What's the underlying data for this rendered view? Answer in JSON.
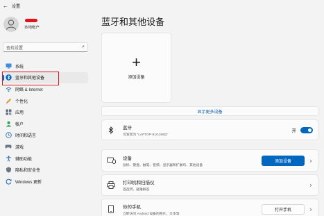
{
  "titlebar": {
    "back_icon": "back-arrow-icon",
    "title": "设置"
  },
  "profile": {
    "account_type": "本地帐户"
  },
  "search": {
    "placeholder": "查找设置"
  },
  "nav": [
    {
      "label": "系统",
      "icon": "monitor-icon"
    },
    {
      "label": "蓝牙和其他设备",
      "icon": "bluetooth-icon"
    },
    {
      "label": "网络 & Internet",
      "icon": "wifi-icon"
    },
    {
      "label": "个性化",
      "icon": "brush-icon"
    },
    {
      "label": "应用",
      "icon": "apps-icon"
    },
    {
      "label": "帐户",
      "icon": "person-icon"
    },
    {
      "label": "时间和语言",
      "icon": "globe-clock-icon"
    },
    {
      "label": "游戏",
      "icon": "controller-icon"
    },
    {
      "label": "辅助功能",
      "icon": "accessibility-icon"
    },
    {
      "label": "隐私和安全性",
      "icon": "shield-icon"
    },
    {
      "label": "Windows 更新",
      "icon": "update-icon"
    }
  ],
  "main": {
    "title": "蓝牙和其他设备",
    "add_device_label": "添加设备",
    "show_more": "显示更多设备",
    "bluetooth": {
      "title": "蓝牙",
      "subtitle": "可发现为 \"LAPTOP-61G199Q\"",
      "toggle_label": "开",
      "on": true
    },
    "devices": {
      "title": "设备",
      "subtitle": "鼠标、键盘、触笔、音频、显示器和扩展坞、其他设备",
      "button": "添加设备"
    },
    "printers": {
      "title": "打印机和扫描仪",
      "subtitle": "首选项，疑难解答"
    },
    "phone": {
      "title": "你的手机",
      "subtitle": "立即访问 Android 设备的照片、文本等",
      "button": "打开手机"
    }
  },
  "colors": {
    "accent": "#0067c0",
    "highlight": "#e0141e"
  }
}
